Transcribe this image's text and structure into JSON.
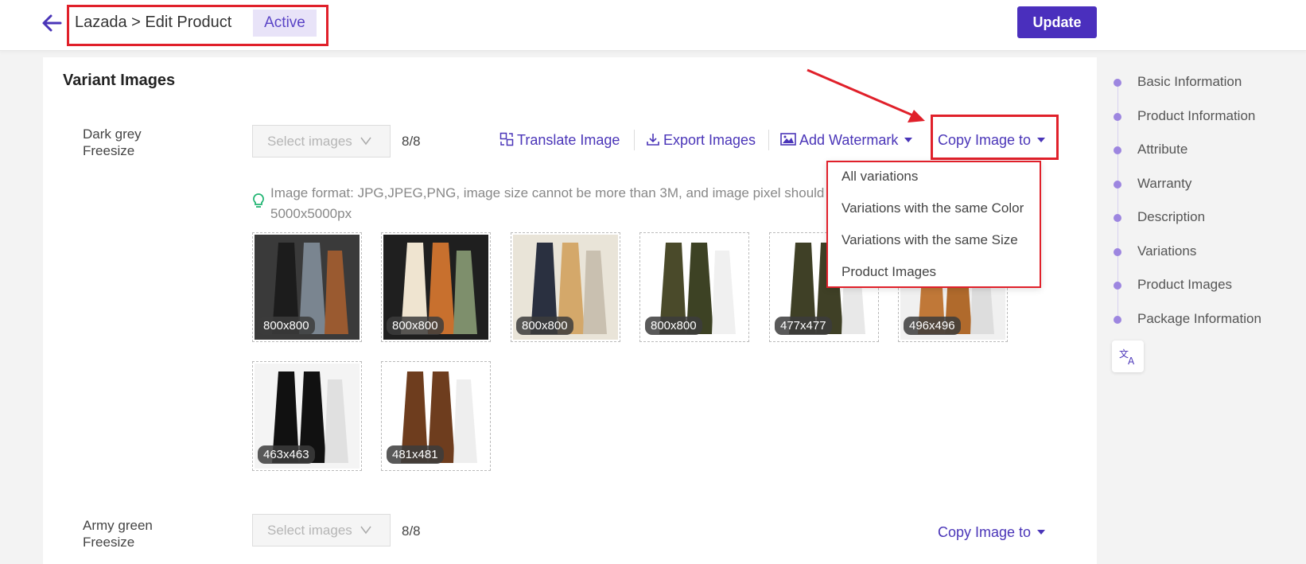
{
  "header": {
    "title": "Lazada > Edit Product",
    "status": "Active",
    "update_label": "Update"
  },
  "section": {
    "title": "Variant Images"
  },
  "variants": [
    {
      "name_line1": "Dark grey",
      "name_line2": "Freesize",
      "select_placeholder": "Select images",
      "count": "8/8",
      "images": [
        {
          "size": "800x800",
          "colors": [
            "#1c1c1c",
            "#3a3a3a",
            "#7a8590",
            "#9a5a30"
          ]
        },
        {
          "size": "800x800",
          "colors": [
            "#efe4d0",
            "#1f1f1f",
            "#c8702e",
            "#7e8f6c"
          ]
        },
        {
          "size": "800x800",
          "colors": [
            "#2a3040",
            "#e9e4d8",
            "#d4a86a",
            "#c9c0b0"
          ]
        },
        {
          "size": "800x800",
          "colors": [
            "#4a4a2a",
            "#ffffff",
            "#3d4224",
            "#f0f0f0"
          ]
        },
        {
          "size": "477x477",
          "colors": [
            "#3f4026",
            "#ffffff",
            "#3f4026",
            "#e8e8e8"
          ]
        },
        {
          "size": "496x496",
          "colors": [
            "#c07838",
            "#f0f0f0",
            "#b06a2c",
            "#dddddd"
          ]
        },
        {
          "size": "463x463",
          "colors": [
            "#111111",
            "#f4f4f4",
            "#111111",
            "#e0e0e0"
          ]
        },
        {
          "size": "481x481",
          "colors": [
            "#6e3d1e",
            "#ffffff",
            "#6e3d1e",
            "#eeeeee"
          ]
        }
      ]
    },
    {
      "name_line1": "Army green",
      "name_line2": "Freesize",
      "select_placeholder": "Select images",
      "count": "8/8"
    }
  ],
  "toolbar": {
    "translate": "Translate Image",
    "export": "Export Images",
    "watermark": "Add Watermark",
    "copy": "Copy Image to"
  },
  "hint": "Image format: JPG,JPEG,PNG, image size cannot be more than 3M, and image pixel should 5000x5000px",
  "dropdown": {
    "items": [
      "All variations",
      "Variations with the same Color",
      "Variations with the same Size",
      "Product Images"
    ]
  },
  "nav": {
    "items": [
      "Basic Information",
      "Product Information",
      "Attribute",
      "Warranty",
      "Description",
      "Variations",
      "Product Images",
      "Package Information"
    ]
  },
  "colors": {
    "accent": "#4a2fbd",
    "link": "#4a35b8",
    "highlight": "#e0202a",
    "badge_bg": "#e8e3f8"
  },
  "icons": [
    "arrow-left-icon",
    "translate-image-icon",
    "download-icon",
    "image-icon",
    "bulb-icon",
    "translate-icon"
  ]
}
